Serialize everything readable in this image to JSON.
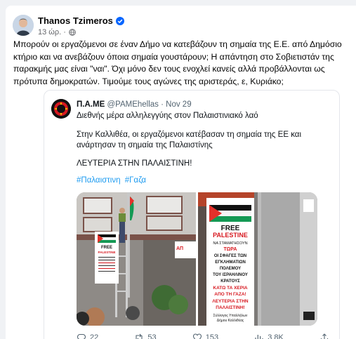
{
  "post": {
    "author": "Thanos Tzimeros",
    "time": "13 ώρ. ·",
    "text": "Μπορούν οι εργαζόμενοι σε έναν Δήμο να κατεβάζουν τη σημαία της Ε.Ε. από Δημόσιο κτήριο και να ανεβάζουν όποια σημαία γουστάρουν; Η απάντηση στο Σοβιετιστάν της παρακμής μας είναι \"ναι\". Όχι μόνο δεν τους ενοχλεί κανείς αλλά προβάλλονται ως πρότυπα δημοκρατών. Τιμούμε τους αγώνες της αριστεράς, ε, Κυριάκο;"
  },
  "quote": {
    "name": "Π.Α.ΜΕ",
    "handle": "@PAMEhellas",
    "date": "· Nov 29",
    "bio": "Διεθνής μέρα αλληλεγγύης στον Παλαιστινιακό λαό",
    "body": "Στην Καλλιθέα, οι εργαζόμενοι κατέβασαν τη σημαία της ΕΕ και ανάρτησαν τη σημαία της Παλαιστίνης",
    "shout": "ΛΕΥΤΕΡΙΑ ΣΤΗΝ ΠΑΛΑΙΣΤΙΝΗ!",
    "tags": [
      "#Παλαιστινη",
      "#Γαζα"
    ],
    "banner1": [
      "FREE",
      "PALESTINE"
    ],
    "banner2": [
      "FREE",
      "PALESTINE"
    ],
    "banner_text": [
      "ΝΑ ΣΤΑΜΑΤΗΣΟΥΝ",
      "ΤΩΡΑ",
      "ΟΙ ΣΦΑΓΕΣ ΤΩΝ",
      "ΕΓΚΛΗΜΑΤΙΩΝ",
      "ΠΟΛΕΜΟΥ",
      "ΤΟΥ ΙΣΡΑΗΛΙΝΟΥ",
      "ΚΡΑΤΟΥΣ",
      "ΚΑΤΩ ΤΑ ΧΕΡΙΑ",
      "ΑΠΟ ΤΗ ΓΑΖΑ!",
      "ΛΕΥΤΕΡΙΑ ΣΤΗΝ",
      "ΠΑΛΑΙΣΤΙΝΗ!"
    ],
    "banner_sign": [
      "Σύλλογος Υπαλλήλων",
      "Δήμου Καλλιθέας"
    ],
    "stats": {
      "replies": "22",
      "reposts": "53",
      "likes": "153",
      "views": "3.8K"
    }
  },
  "colors": {
    "accent": "#0866ff",
    "hashtag": "#1d9bf0",
    "flag_red": "#e4312b",
    "flag_green": "#149954"
  }
}
